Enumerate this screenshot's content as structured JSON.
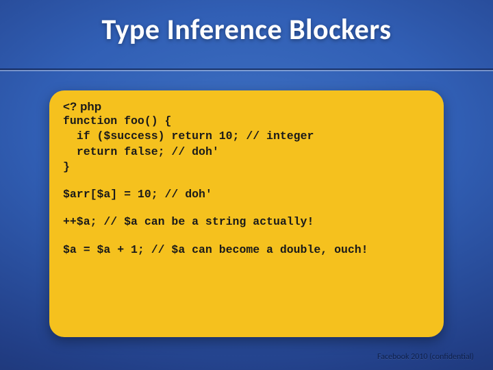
{
  "slide": {
    "title": "Type Inference Blockers",
    "footer": "Facebook 2010 (confidential)"
  },
  "code": {
    "opentag": "<? php",
    "line1": "function foo() {",
    "line2": "  if ($success) return 10; // integer",
    "line3": "  return false; // doh'",
    "line4": "}",
    "arr": "$arr[$a] = 10; // doh'",
    "inc": "++$a; // $a can be a string actually!",
    "sum": "$a = $a + 1; // $a can become a double, ouch!"
  }
}
